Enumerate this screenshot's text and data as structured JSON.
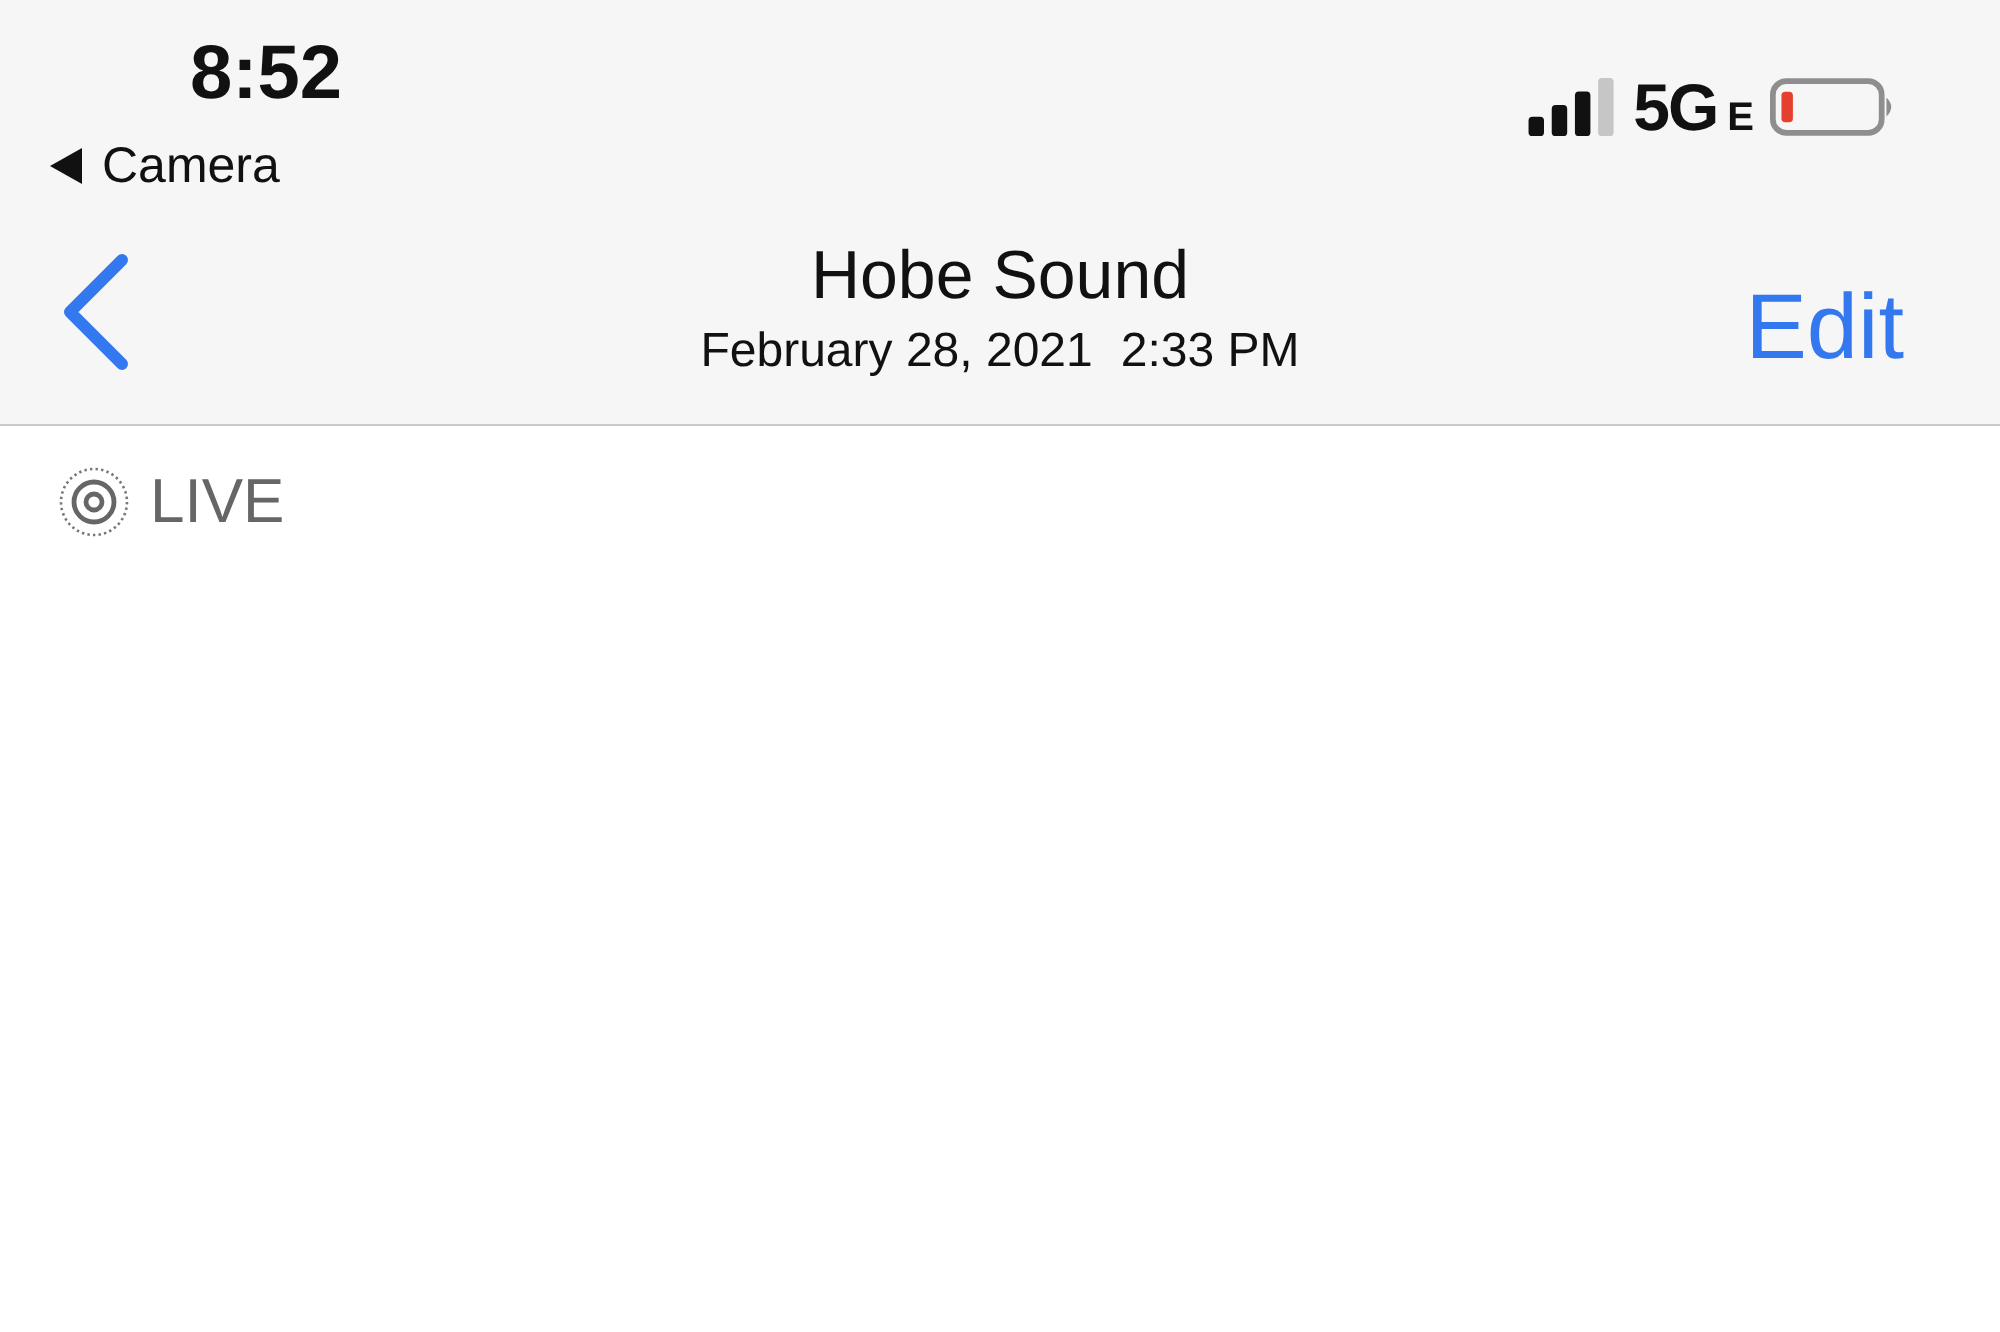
{
  "status_bar": {
    "time": "8:52",
    "back_to_app": "Camera",
    "network": "5G",
    "network_suffix": "E"
  },
  "nav_bar": {
    "title": "Hobe Sound",
    "date": "February 28, 2021",
    "time": "2:33 PM",
    "edit_button": "Edit"
  },
  "live_badge": {
    "label": "LIVE"
  }
}
